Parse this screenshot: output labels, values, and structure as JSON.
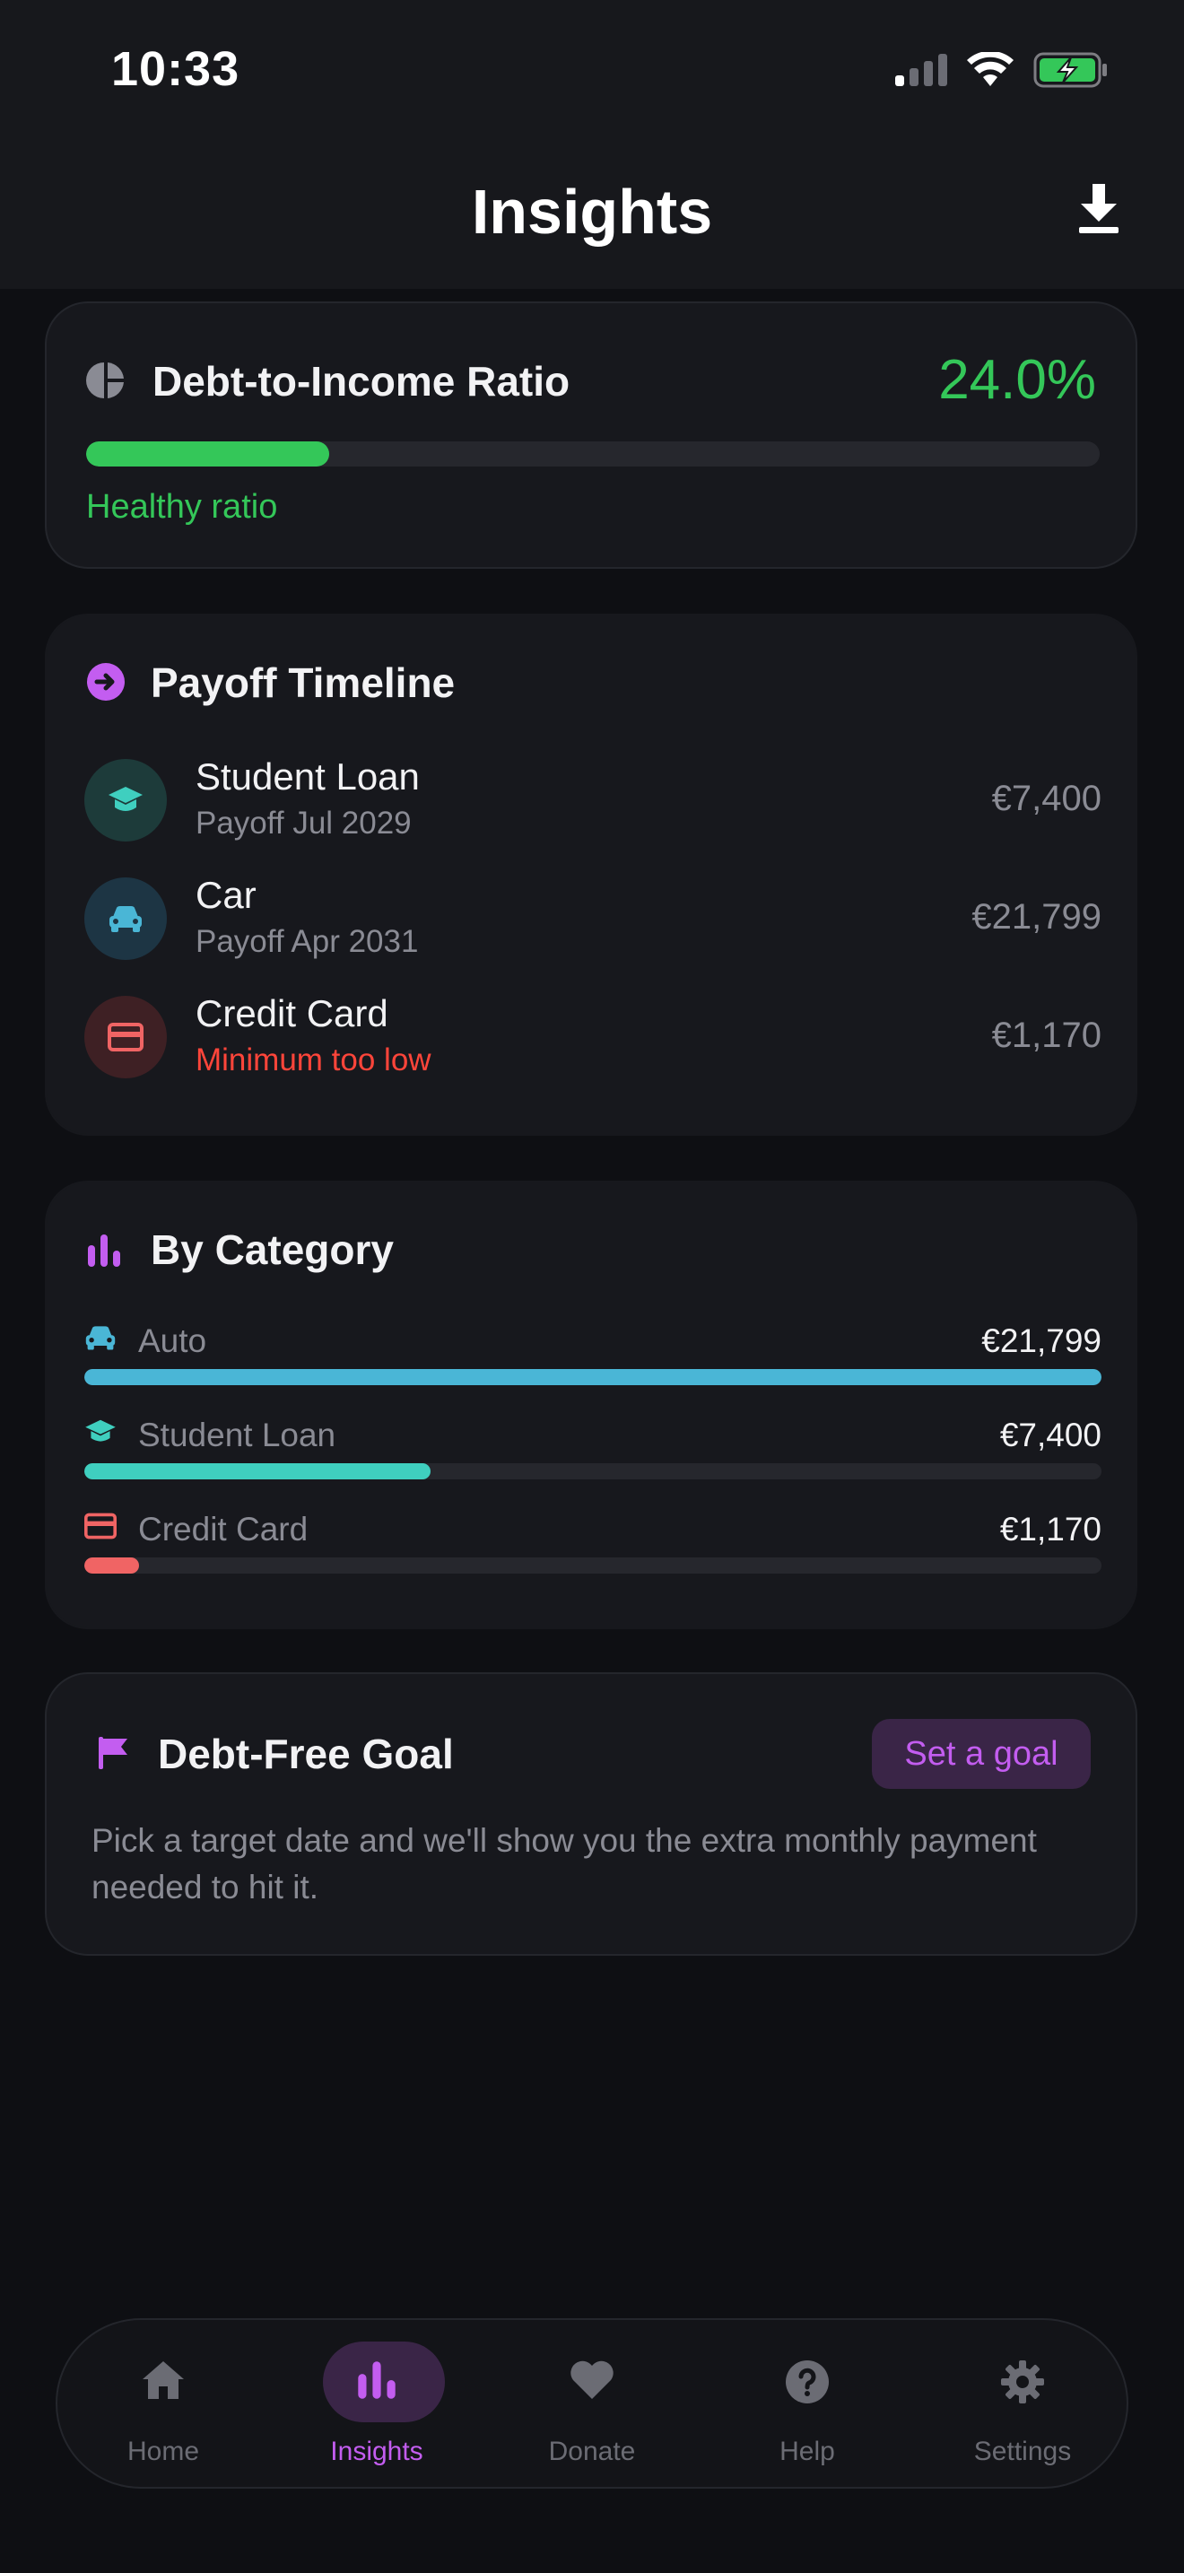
{
  "status_bar": {
    "time": "10:33"
  },
  "header": {
    "title": "Insights"
  },
  "dti": {
    "title": "Debt-to-Income Ratio",
    "value": "24.0%",
    "progress_fraction": 0.24,
    "note": "Healthy ratio",
    "accent": "#34c759"
  },
  "timeline": {
    "title": "Payoff Timeline",
    "items": [
      {
        "name": "Student Loan",
        "sub": "Payoff Jul 2029",
        "amount": "€7,400",
        "icon": "graduation-cap-icon",
        "color": "#3fcfbf"
      },
      {
        "name": "Car",
        "sub": "Payoff Apr 2031",
        "amount": "€21,799",
        "icon": "car-icon",
        "color": "#4ab6d6"
      },
      {
        "name": "Credit Card",
        "sub": "Minimum too low",
        "amount": "€1,170",
        "icon": "credit-card-icon",
        "color": "#f06464"
      }
    ]
  },
  "category": {
    "title": "By Category",
    "items": [
      {
        "name": "Auto",
        "amount": "€21,799",
        "fraction": 1.0,
        "color": "#4ab6d6",
        "icon": "car-icon"
      },
      {
        "name": "Student Loan",
        "amount": "€7,400",
        "fraction": 0.34,
        "color": "#3fcfbf",
        "icon": "graduation-cap-icon"
      },
      {
        "name": "Credit Card",
        "amount": "€1,170",
        "fraction": 0.054,
        "color": "#f06464",
        "icon": "credit-card-icon"
      }
    ]
  },
  "goal": {
    "title": "Debt-Free Goal",
    "button": "Set a goal",
    "description": "Pick a target date and we'll show you the extra monthly payment needed to hit it."
  },
  "tabs": [
    {
      "label": "Home",
      "icon": "home-icon"
    },
    {
      "label": "Insights",
      "icon": "bar-chart-icon",
      "active": true
    },
    {
      "label": "Donate",
      "icon": "heart-icon"
    },
    {
      "label": "Help",
      "icon": "help-icon"
    },
    {
      "label": "Settings",
      "icon": "gear-icon"
    }
  ],
  "colors": {
    "accent": "#c35df0",
    "background": "#0e0f13",
    "card": "#17181d"
  }
}
